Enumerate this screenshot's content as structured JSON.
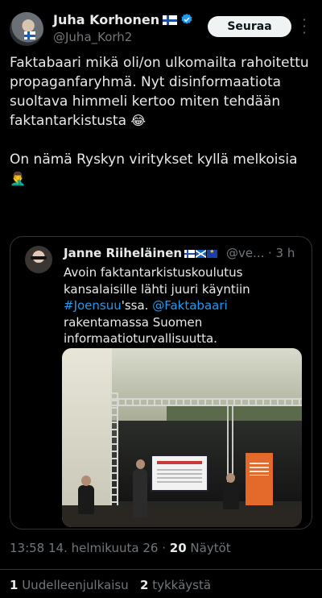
{
  "author": {
    "name": "Juha Korhonen",
    "handle": "@Juha_Korh2",
    "follow_label": "Seuraa"
  },
  "tweet": {
    "paragraph1": "Faktabaari mikä oli/on ulkomailta rahoitettu propaganfaryhmä. Nyt disinformaatiota suoltava himmeli kertoo miten tehdään faktantarkistusta",
    "emoji1": "😂",
    "paragraph2": "On nämä Ryskyn viritykset kyllä melkoisia",
    "emoji2": "🤦‍♂️"
  },
  "quote": {
    "name": "Janne Riiheläinen",
    "handle": "@ve...",
    "time": "· 3 h",
    "text_1": "Avoin faktantarkistuskoulutus kansalaisille lähti juuri käyntiin ",
    "link_1": "#Joensuu",
    "text_2": "'ssa. ",
    "link_2": "@Faktabaari",
    "text_3": " rakentamassa Suomen informaatioturvallisuutta."
  },
  "meta": {
    "time": "13:58 14. helmikuuta 26 · ",
    "views_count": "20",
    "views_label": " Näytöt"
  },
  "engagement": {
    "reposts_count": "1",
    "reposts_label": " Uudelleenjulkaisu",
    "likes_count": "2",
    "likes_label": " tykkäystä"
  },
  "colors": {
    "background": "#000000",
    "text": "#e7e9ea",
    "secondary": "#71767b",
    "link": "#1d9bf0",
    "verified": "#1d9bf0"
  }
}
